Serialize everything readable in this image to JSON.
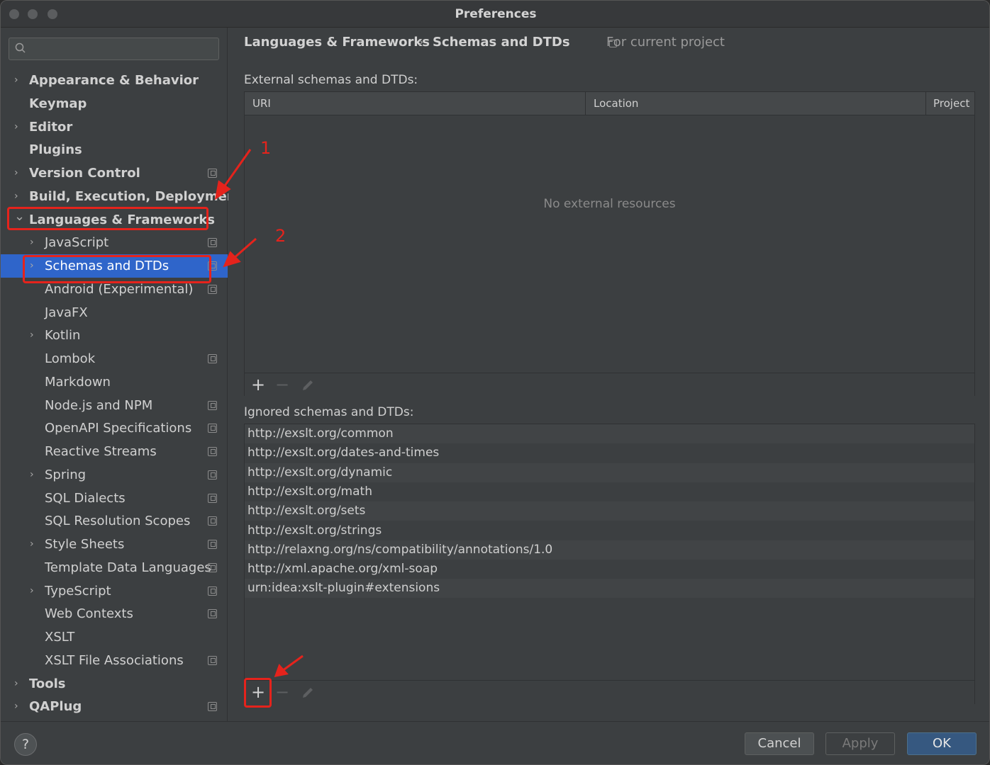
{
  "window": {
    "title": "Preferences"
  },
  "sidebar": {
    "search_placeholder": "",
    "items": [
      {
        "label": "Appearance & Behavior",
        "level": 0,
        "expandable": true,
        "project": false,
        "selected": false
      },
      {
        "label": "Keymap",
        "level": 0,
        "expandable": false,
        "project": false,
        "selected": false
      },
      {
        "label": "Editor",
        "level": 0,
        "expandable": true,
        "project": false,
        "selected": false
      },
      {
        "label": "Plugins",
        "level": 0,
        "expandable": false,
        "project": false,
        "selected": false
      },
      {
        "label": "Version Control",
        "level": 0,
        "expandable": true,
        "project": true,
        "selected": false
      },
      {
        "label": "Build, Execution, Deployment",
        "level": 0,
        "expandable": true,
        "project": false,
        "selected": false
      },
      {
        "label": "Languages & Frameworks",
        "level": 0,
        "expandable": true,
        "expanded": true,
        "project": false,
        "selected": false
      },
      {
        "label": "JavaScript",
        "level": 1,
        "expandable": true,
        "project": true,
        "selected": false
      },
      {
        "label": "Schemas and DTDs",
        "level": 1,
        "expandable": true,
        "project": true,
        "selected": true
      },
      {
        "label": "Android (Experimental)",
        "level": 1,
        "expandable": false,
        "project": true,
        "selected": false
      },
      {
        "label": "JavaFX",
        "level": 1,
        "expandable": false,
        "project": false,
        "selected": false
      },
      {
        "label": "Kotlin",
        "level": 1,
        "expandable": true,
        "project": false,
        "selected": false
      },
      {
        "label": "Lombok",
        "level": 1,
        "expandable": false,
        "project": true,
        "selected": false
      },
      {
        "label": "Markdown",
        "level": 1,
        "expandable": false,
        "project": false,
        "selected": false
      },
      {
        "label": "Node.js and NPM",
        "level": 1,
        "expandable": false,
        "project": true,
        "selected": false
      },
      {
        "label": "OpenAPI Specifications",
        "level": 1,
        "expandable": false,
        "project": true,
        "selected": false
      },
      {
        "label": "Reactive Streams",
        "level": 1,
        "expandable": false,
        "project": true,
        "selected": false
      },
      {
        "label": "Spring",
        "level": 1,
        "expandable": true,
        "project": true,
        "selected": false
      },
      {
        "label": "SQL Dialects",
        "level": 1,
        "expandable": false,
        "project": true,
        "selected": false
      },
      {
        "label": "SQL Resolution Scopes",
        "level": 1,
        "expandable": false,
        "project": true,
        "selected": false
      },
      {
        "label": "Style Sheets",
        "level": 1,
        "expandable": true,
        "project": true,
        "selected": false
      },
      {
        "label": "Template Data Languages",
        "level": 1,
        "expandable": false,
        "project": true,
        "selected": false
      },
      {
        "label": "TypeScript",
        "level": 1,
        "expandable": true,
        "project": true,
        "selected": false
      },
      {
        "label": "Web Contexts",
        "level": 1,
        "expandable": false,
        "project": true,
        "selected": false
      },
      {
        "label": "XSLT",
        "level": 1,
        "expandable": false,
        "project": false,
        "selected": false
      },
      {
        "label": "XSLT File Associations",
        "level": 1,
        "expandable": false,
        "project": true,
        "selected": false
      },
      {
        "label": "Tools",
        "level": 0,
        "expandable": true,
        "project": false,
        "selected": false
      },
      {
        "label": "QAPlug",
        "level": 0,
        "expandable": true,
        "project": true,
        "selected": false
      }
    ]
  },
  "main": {
    "breadcrumb": {
      "parent": "Languages & Frameworks",
      "separator": "›",
      "current": "Schemas and DTDs",
      "scope": "For current project"
    },
    "external": {
      "label": "External schemas and DTDs:",
      "columns": [
        "URI",
        "Location",
        "Project"
      ],
      "empty_text": "No external resources"
    },
    "ignored": {
      "label": "Ignored schemas and DTDs:",
      "rows": [
        "http://exslt.org/common",
        "http://exslt.org/dates-and-times",
        "http://exslt.org/dynamic",
        "http://exslt.org/math",
        "http://exslt.org/sets",
        "http://exslt.org/strings",
        "http://relaxng.org/ns/compatibility/annotations/1.0",
        "http://xml.apache.org/xml-soap",
        "urn:idea:xslt-plugin#extensions"
      ]
    },
    "toolbar": {
      "add": "+",
      "remove": "−",
      "edit_icon": "pencil-icon"
    }
  },
  "footer": {
    "help": "?",
    "cancel": "Cancel",
    "apply": "Apply",
    "ok": "OK"
  },
  "annotations": {
    "marker_1": "1",
    "marker_2": "2"
  },
  "colors": {
    "selection": "#2f65ca",
    "annotation": "#e5231c",
    "ok_button": "#365880"
  }
}
